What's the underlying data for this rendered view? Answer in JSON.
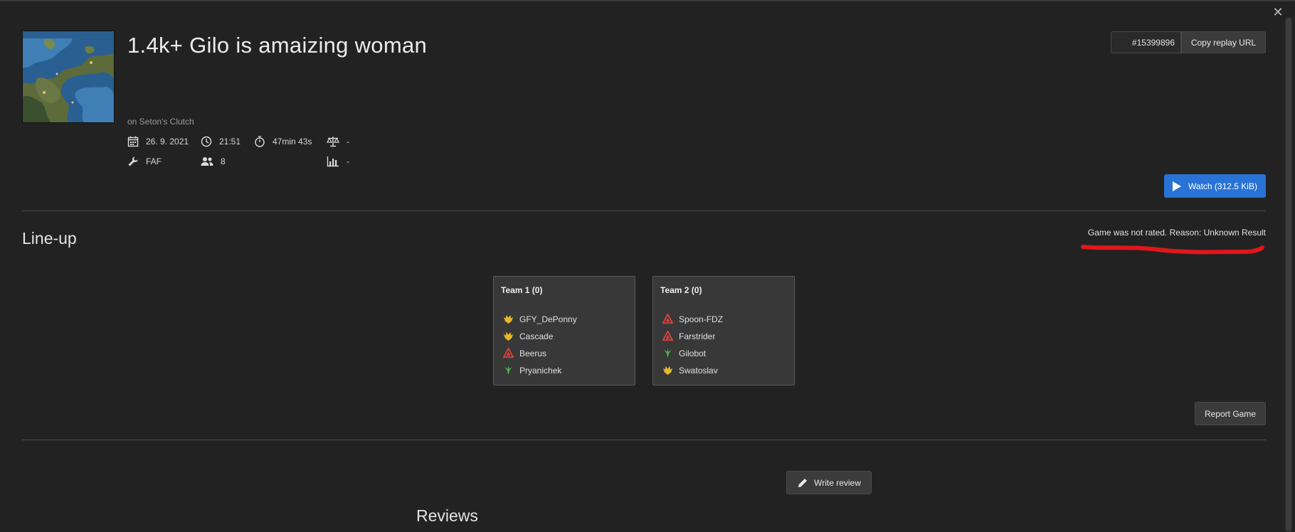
{
  "window": {
    "close_glyph": "✕"
  },
  "replay": {
    "title": "1.4k+ Gilo is amaizing woman",
    "map_line": "on Seton's Clutch",
    "date": "26. 9. 2021",
    "time": "21:51",
    "duration": "47min 43s",
    "balance": "-",
    "featured_mod": "FAF",
    "player_count": "8",
    "rating": "-",
    "id": "#15399896"
  },
  "actions": {
    "copy_url_label": "Copy replay URL",
    "watch_label": "Watch (312.5 KiB)",
    "report_label": "Report Game",
    "write_review_label": "Write review"
  },
  "lineup": {
    "heading": "Line-up",
    "rating_note": "Game was not rated. Reason: Unknown Result",
    "teams": [
      {
        "name": "Team 1 (0)",
        "players": [
          {
            "name": "GFY_DePonny",
            "faction": "aeon-icon",
            "color": "#e8b62a"
          },
          {
            "name": "Cascade",
            "faction": "aeon-icon",
            "color": "#e8b62a"
          },
          {
            "name": "Beerus",
            "faction": "cybran-icon",
            "color": "#d9423a"
          },
          {
            "name": "Pryanichek",
            "faction": "seraphim-icon",
            "color": "#4cae4c"
          }
        ]
      },
      {
        "name": "Team 2 (0)",
        "players": [
          {
            "name": "Spoon-FDZ",
            "faction": "cybran-icon",
            "color": "#d9423a"
          },
          {
            "name": "Farstrider",
            "faction": "cybran-icon",
            "color": "#d9423a"
          },
          {
            "name": "Gilobot",
            "faction": "seraphim-icon",
            "color": "#4cae4c"
          },
          {
            "name": "Swatoslav",
            "faction": "aeon-icon",
            "color": "#e8b62a"
          }
        ]
      }
    ]
  },
  "reviews": {
    "heading": "Reviews"
  },
  "colors": {
    "accent": "#2a73d6",
    "annotation": "#e0161b",
    "background": "#222222"
  }
}
